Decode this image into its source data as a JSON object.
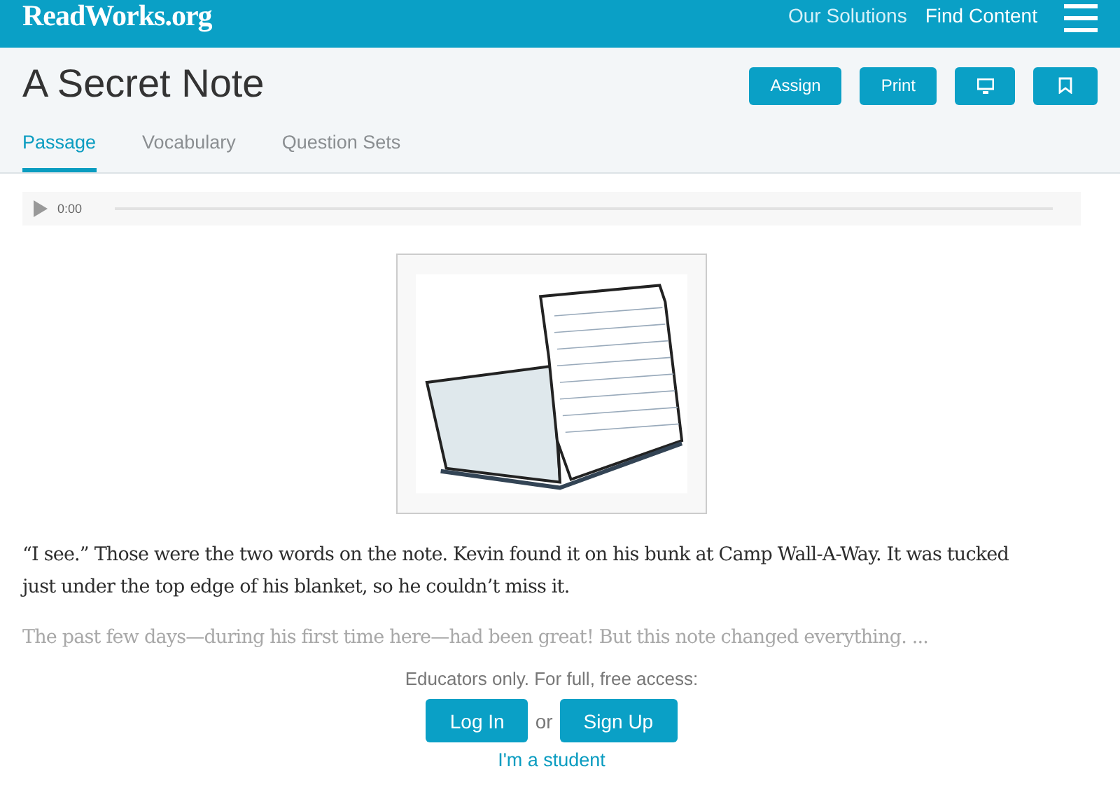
{
  "header": {
    "logo": "ReadWorks",
    "logo_suffix": ".org",
    "nav": [
      "Our Solutions",
      "Find Content"
    ]
  },
  "title": "A Secret Note",
  "actions": [
    {
      "kind": "text",
      "label": "Assign"
    },
    {
      "kind": "text",
      "label": "Print"
    },
    {
      "kind": "monitor"
    },
    {
      "kind": "bookmark"
    }
  ],
  "tabs": [
    {
      "label": "Passage",
      "selected": true
    },
    {
      "label": "Vocabulary",
      "selected": false
    },
    {
      "label": "Question Sets",
      "selected": false
    }
  ],
  "audio": {
    "time": "0:00"
  },
  "paragraphs": [
    {
      "text": "“I see.”  Those were the two words on the note. Kevin found it on his bunk at Camp Wall-A-Way. It was tucked just under the top edge of his blanket, so he couldn’t miss it.",
      "faded": false
    },
    {
      "text": "The past few days—during his first time here—had been great! But this note changed everything. ...",
      "faded": true
    }
  ],
  "access": {
    "prompt": "Educators only. For full, free access:",
    "login": "Log In",
    "or": "or",
    "signup": "Sign Up",
    "student": "I'm a student"
  }
}
